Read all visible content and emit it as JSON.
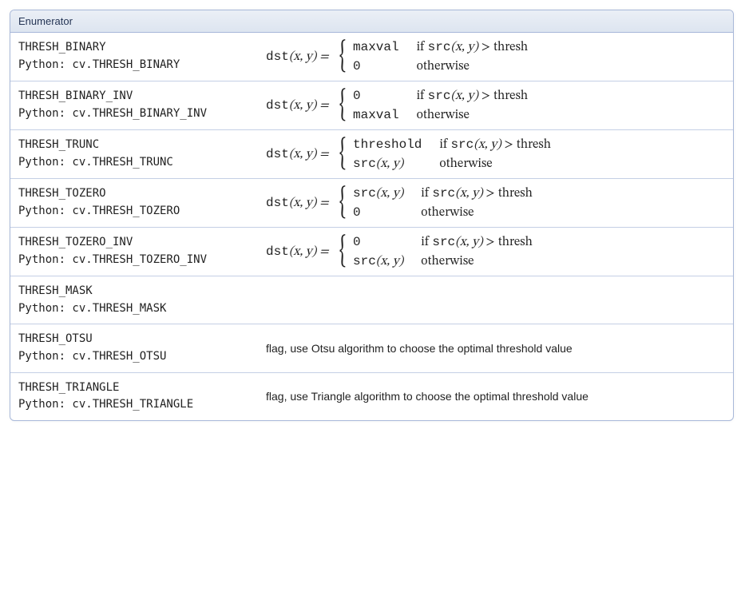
{
  "header": "Enumerator",
  "rows": [
    {
      "name": "THRESH_BINARY",
      "python": "Python: cv.THRESH_BINARY",
      "formula": {
        "lhs_tt": "dst",
        "args": "(x, y)",
        "cases": [
          {
            "val_tt": "maxval",
            "cond_prefix": "if ",
            "cond_tt": "src",
            "cond_args": "(x, y)",
            "cond_suffix": " > thresh"
          },
          {
            "val_tt": "0",
            "cond_plain": "otherwise"
          }
        ]
      }
    },
    {
      "name": "THRESH_BINARY_INV",
      "python": "Python: cv.THRESH_BINARY_INV",
      "formula": {
        "lhs_tt": "dst",
        "args": "(x, y)",
        "cases": [
          {
            "val_tt": "0",
            "cond_prefix": "if ",
            "cond_tt": "src",
            "cond_args": "(x, y)",
            "cond_suffix": " > thresh"
          },
          {
            "val_tt": "maxval",
            "cond_plain": "otherwise"
          }
        ]
      }
    },
    {
      "name": "THRESH_TRUNC",
      "python": "Python: cv.THRESH_TRUNC",
      "formula": {
        "lhs_tt": "dst",
        "args": "(x, y)",
        "cases": [
          {
            "val_tt": "threshold",
            "cond_prefix": "if ",
            "cond_tt": "src",
            "cond_args": "(x, y)",
            "cond_suffix": " > thresh"
          },
          {
            "val_serif_tt": "src",
            "val_args": "(x, y)",
            "cond_plain": "otherwise"
          }
        ]
      }
    },
    {
      "name": "THRESH_TOZERO",
      "python": "Python: cv.THRESH_TOZERO",
      "formula": {
        "lhs_tt": "dst",
        "args": "(x, y)",
        "cases": [
          {
            "val_serif_tt": "src",
            "val_args": "(x, y)",
            "cond_prefix": "if ",
            "cond_tt": "src",
            "cond_args": "(x, y)",
            "cond_suffix": " > thresh"
          },
          {
            "val_tt": "0",
            "cond_plain": "otherwise"
          }
        ]
      }
    },
    {
      "name": "THRESH_TOZERO_INV",
      "python": "Python: cv.THRESH_TOZERO_INV",
      "formula": {
        "lhs_tt": "dst",
        "args": "(x, y)",
        "cases": [
          {
            "val_tt": "0",
            "cond_prefix": "if ",
            "cond_tt": "src",
            "cond_args": "(x, y)",
            "cond_suffix": " > thresh"
          },
          {
            "val_serif_tt": "src",
            "val_args": "(x, y)",
            "cond_plain": "otherwise"
          }
        ]
      }
    },
    {
      "name": "THRESH_MASK",
      "python": "Python: cv.THRESH_MASK",
      "description": ""
    },
    {
      "name": "THRESH_OTSU",
      "python": "Python: cv.THRESH_OTSU",
      "description": "flag, use Otsu algorithm to choose the optimal threshold value"
    },
    {
      "name": "THRESH_TRIANGLE",
      "python": "Python: cv.THRESH_TRIANGLE",
      "description": "flag, use Triangle algorithm to choose the optimal threshold value"
    }
  ]
}
